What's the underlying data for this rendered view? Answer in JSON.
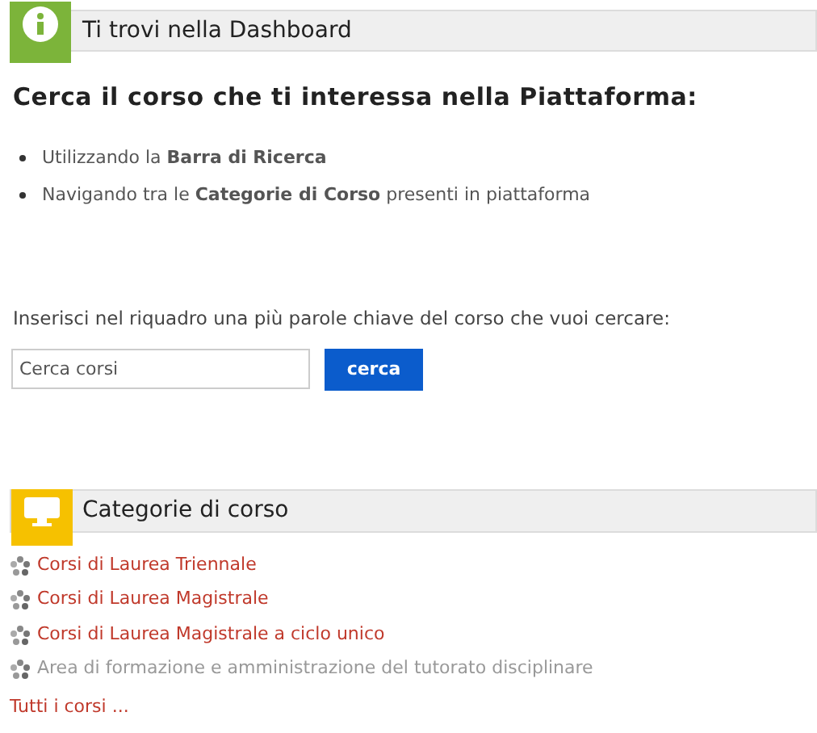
{
  "dashboard_header": {
    "title": "Ti trovi nella Dashboard"
  },
  "heading": "Cerca il corso che ti interessa nella Piattaforma:",
  "bullets": [
    "Utilizzando la **Barra di Ricerca**",
    "Navigando tra le **Categorie di Corso** presenti in piattaforma"
  ],
  "search": {
    "label": "Inserisci nel riquadro una più parole chiave del corso che vuoi cercare:",
    "placeholder": "Cerca corsi",
    "button": "cerca"
  },
  "categories_header": {
    "title": "Categorie di corso"
  },
  "categories": [
    {
      "label": "Corsi di Laurea Triennale",
      "dimmed": false
    },
    {
      "label": "Corsi di Laurea Magistrale",
      "dimmed": false
    },
    {
      "label": "Corsi di Laurea Magistrale a ciclo unico",
      "dimmed": false
    },
    {
      "label": "Area di formazione e amministrazione del tutorato disciplinare",
      "dimmed": true
    }
  ],
  "all_courses_link": "Tutti i corsi ..."
}
